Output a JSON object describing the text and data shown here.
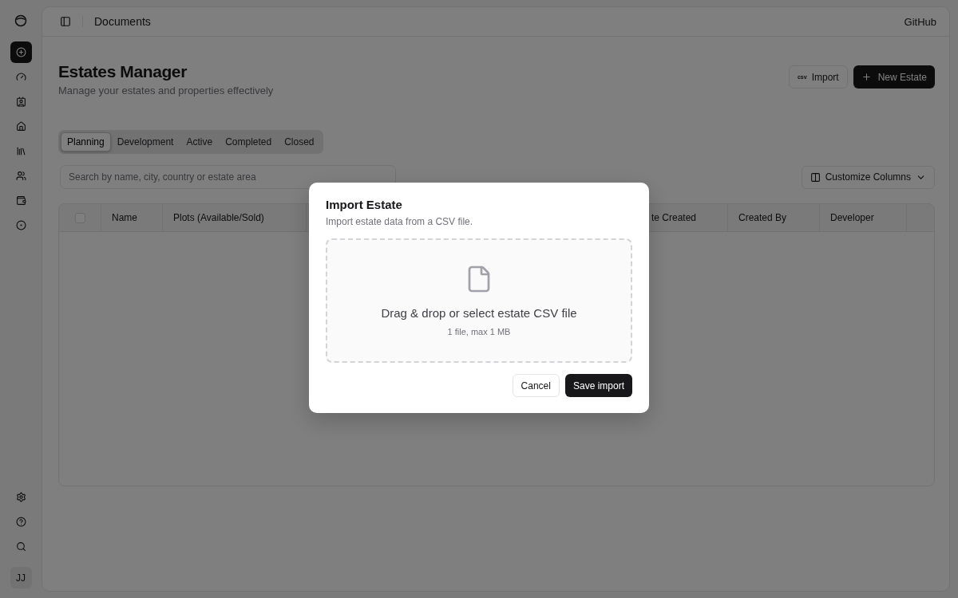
{
  "sidebar": {
    "items": [
      {
        "selected": true
      },
      {
        "selected": false
      },
      {
        "selected": false
      },
      {
        "selected": false
      },
      {
        "selected": false
      },
      {
        "selected": false
      },
      {
        "selected": false
      },
      {
        "selected": false
      }
    ],
    "avatar": "JJ"
  },
  "header": {
    "breadcrumb": "Documents",
    "link": "GitHub"
  },
  "page": {
    "title": "Estates Manager",
    "subtitle": "Manage your estates and properties effectively",
    "import_badge": "csv",
    "import_button": "Import",
    "new_button": "New Estate"
  },
  "tabs": [
    {
      "label": "Planning",
      "selected": true
    },
    {
      "label": "Development",
      "selected": false
    },
    {
      "label": "Active",
      "selected": false
    },
    {
      "label": "Completed",
      "selected": false
    },
    {
      "label": "Closed",
      "selected": false
    }
  ],
  "search": {
    "placeholder": "Search by name, city, country or estate area"
  },
  "customize_button": "Customize Columns",
  "table": {
    "select_all_checked": false,
    "columns_left": [
      "Name",
      "Plots (Available/Sold)"
    ],
    "columns_right": [
      "te Created",
      "Created By",
      "Developer"
    ]
  },
  "dialog": {
    "title": "Import Estate",
    "description": "Import estate data from a CSV file.",
    "dropzone_text": "Drag & drop or select estate CSV file",
    "dropzone_hint": "1 file, max 1 MB",
    "cancel": "Cancel",
    "save": "Save import"
  }
}
